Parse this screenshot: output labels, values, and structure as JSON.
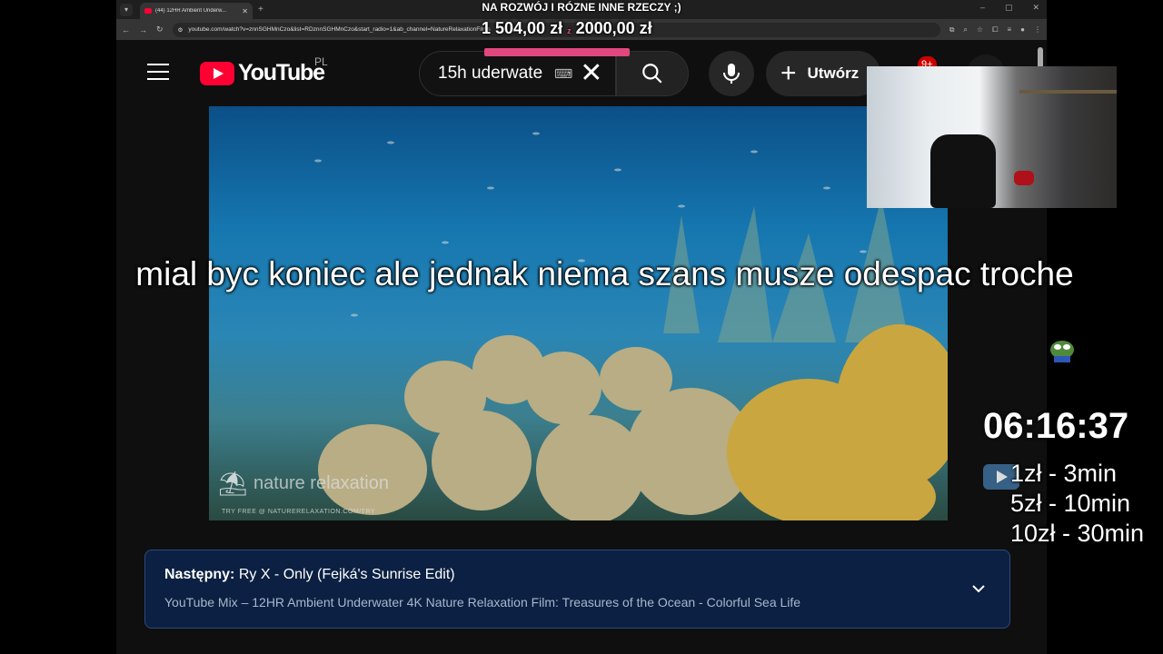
{
  "stream": {
    "banner": "NA ROZWÓJ I RÓZNE INNE RZECZY ;)",
    "donation_current": "1 504,00 zł",
    "donation_goal": "2000,00 zł",
    "caption": "mial byc koniec ale jednak niema szans musze odespac troche",
    "timer": "06:16:37",
    "prices": [
      "1zł - 3min",
      "5zł - 10min",
      "10zł - 30min"
    ]
  },
  "browser": {
    "tab_title": "(44) 12HR Ambient Underw...",
    "url": "youtube.com/watch?v=znnSGHMnCzo&list=RDznnSGHMnCzo&start_radio=1&ab_channel=NatureRelaxationFilms"
  },
  "youtube": {
    "wordmark": "YouTube",
    "region": "PL",
    "search_query": "15h uderwate",
    "create_label": "Utwórz",
    "notifications": "9+",
    "watermark_brand": "nature relaxation",
    "watermark_sub": "TRY FREE @ NATURERELAXATION.COM/TRY",
    "up_next_label": "Następny:",
    "up_next_title": "Ry X - Only (Fejká's Sunrise Edit)",
    "up_next_subtitle": "YouTube Mix – 12HR Ambient Underwater 4K Nature Relaxation Film: Treasures of the Ocean - Colorful Sea Life"
  }
}
